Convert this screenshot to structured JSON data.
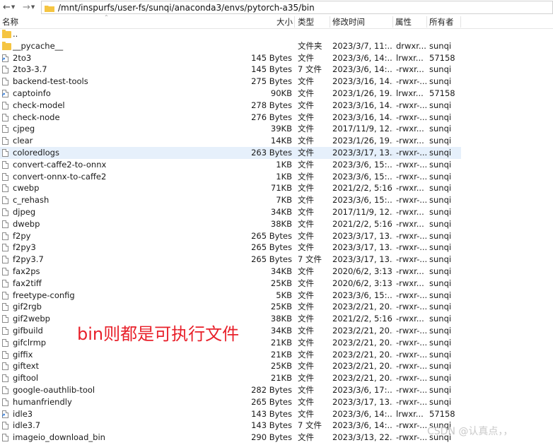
{
  "path": "/mnt/inspurfs/user-fs/sunqi/anaconda3/envs/pytorch-a35/bin",
  "headers": {
    "name": "名称",
    "size": "大小",
    "type": "类型",
    "modified": "修改时间",
    "attributes": "属性",
    "owner": "所有者"
  },
  "rows": [
    {
      "icon": "folder",
      "name": "..",
      "size": "",
      "type": "",
      "modified": "",
      "perm": "",
      "owner": ""
    },
    {
      "icon": "folder",
      "name": "__pycache__",
      "size": "",
      "type": "文件夹",
      "modified": "2023/3/7, 11:...",
      "perm": "drwxr...",
      "owner": "sunqi"
    },
    {
      "icon": "link",
      "name": "2to3",
      "size": "145 Bytes",
      "type": "文件",
      "modified": "2023/3/6, 14:...",
      "perm": "lrwxr...",
      "owner": "57158"
    },
    {
      "icon": "file",
      "name": "2to3-3.7",
      "size": "145 Bytes",
      "type": "7 文件",
      "modified": "2023/3/6, 14:...",
      "perm": "-rwxr...",
      "owner": "sunqi"
    },
    {
      "icon": "file",
      "name": "backend-test-tools",
      "size": "275 Bytes",
      "type": "文件",
      "modified": "2023/3/16, 14...",
      "perm": "-rwxr-...",
      "owner": "sunqi"
    },
    {
      "icon": "link",
      "name": "captoinfo",
      "size": "90KB",
      "type": "文件",
      "modified": "2023/1/26, 19...",
      "perm": "lrwxr...",
      "owner": "57158"
    },
    {
      "icon": "file",
      "name": "check-model",
      "size": "278 Bytes",
      "type": "文件",
      "modified": "2023/3/16, 14...",
      "perm": "-rwxr-...",
      "owner": "sunqi"
    },
    {
      "icon": "file",
      "name": "check-node",
      "size": "276 Bytes",
      "type": "文件",
      "modified": "2023/3/16, 14...",
      "perm": "-rwxr-...",
      "owner": "sunqi"
    },
    {
      "icon": "file",
      "name": "cjpeg",
      "size": "39KB",
      "type": "文件",
      "modified": "2017/11/9, 12...",
      "perm": "-rwxr...",
      "owner": "sunqi"
    },
    {
      "icon": "file",
      "name": "clear",
      "size": "14KB",
      "type": "文件",
      "modified": "2023/1/26, 19...",
      "perm": "-rwxr...",
      "owner": "sunqi"
    },
    {
      "icon": "file",
      "name": "coloredlogs",
      "size": "263 Bytes",
      "type": "文件",
      "modified": "2023/3/17, 13...",
      "perm": "-rwxr-...",
      "owner": "sunqi",
      "selected": true
    },
    {
      "icon": "file",
      "name": "convert-caffe2-to-onnx",
      "size": "1KB",
      "type": "文件",
      "modified": "2023/3/6, 15:...",
      "perm": "-rwxr-...",
      "owner": "sunqi"
    },
    {
      "icon": "file",
      "name": "convert-onnx-to-caffe2",
      "size": "1KB",
      "type": "文件",
      "modified": "2023/3/6, 15:...",
      "perm": "-rwxr-...",
      "owner": "sunqi"
    },
    {
      "icon": "file",
      "name": "cwebp",
      "size": "71KB",
      "type": "文件",
      "modified": "2021/2/2, 5:16",
      "perm": "-rwxr...",
      "owner": "sunqi"
    },
    {
      "icon": "file",
      "name": "c_rehash",
      "size": "7KB",
      "type": "文件",
      "modified": "2023/3/6, 15:...",
      "perm": "-rwxr-...",
      "owner": "sunqi"
    },
    {
      "icon": "file",
      "name": "djpeg",
      "size": "34KB",
      "type": "文件",
      "modified": "2017/11/9, 12...",
      "perm": "-rwxr...",
      "owner": "sunqi"
    },
    {
      "icon": "file",
      "name": "dwebp",
      "size": "38KB",
      "type": "文件",
      "modified": "2021/2/2, 5:16",
      "perm": "-rwxr...",
      "owner": "sunqi"
    },
    {
      "icon": "file",
      "name": "f2py",
      "size": "265 Bytes",
      "type": "文件",
      "modified": "2023/3/17, 13...",
      "perm": "-rwxr-...",
      "owner": "sunqi"
    },
    {
      "icon": "file",
      "name": "f2py3",
      "size": "265 Bytes",
      "type": "文件",
      "modified": "2023/3/17, 13...",
      "perm": "-rwxr-...",
      "owner": "sunqi"
    },
    {
      "icon": "file",
      "name": "f2py3.7",
      "size": "265 Bytes",
      "type": "7 文件",
      "modified": "2023/3/17, 13...",
      "perm": "-rwxr-...",
      "owner": "sunqi"
    },
    {
      "icon": "file",
      "name": "fax2ps",
      "size": "34KB",
      "type": "文件",
      "modified": "2020/6/2, 3:13",
      "perm": "-rwxr...",
      "owner": "sunqi"
    },
    {
      "icon": "file",
      "name": "fax2tiff",
      "size": "25KB",
      "type": "文件",
      "modified": "2020/6/2, 3:13",
      "perm": "-rwxr...",
      "owner": "sunqi"
    },
    {
      "icon": "file",
      "name": "freetype-config",
      "size": "5KB",
      "type": "文件",
      "modified": "2023/3/6, 15:...",
      "perm": "-rwxr-...",
      "owner": "sunqi"
    },
    {
      "icon": "file",
      "name": "gif2rgb",
      "size": "25KB",
      "type": "文件",
      "modified": "2023/2/21, 20...",
      "perm": "-rwxr-...",
      "owner": "sunqi"
    },
    {
      "icon": "file",
      "name": "gif2webp",
      "size": "38KB",
      "type": "文件",
      "modified": "2021/2/2, 5:16",
      "perm": "-rwxr...",
      "owner": "sunqi"
    },
    {
      "icon": "file",
      "name": "gifbuild",
      "size": "34KB",
      "type": "文件",
      "modified": "2023/2/21, 20...",
      "perm": "-rwxr-...",
      "owner": "sunqi"
    },
    {
      "icon": "file",
      "name": "gifclrmp",
      "size": "21KB",
      "type": "文件",
      "modified": "2023/2/21, 20...",
      "perm": "-rwxr-...",
      "owner": "sunqi"
    },
    {
      "icon": "file",
      "name": "giffix",
      "size": "21KB",
      "type": "文件",
      "modified": "2023/2/21, 20...",
      "perm": "-rwxr-...",
      "owner": "sunqi"
    },
    {
      "icon": "file",
      "name": "giftext",
      "size": "25KB",
      "type": "文件",
      "modified": "2023/2/21, 20...",
      "perm": "-rwxr-...",
      "owner": "sunqi"
    },
    {
      "icon": "file",
      "name": "giftool",
      "size": "21KB",
      "type": "文件",
      "modified": "2023/2/21, 20...",
      "perm": "-rwxr-...",
      "owner": "sunqi"
    },
    {
      "icon": "file",
      "name": "google-oauthlib-tool",
      "size": "282 Bytes",
      "type": "文件",
      "modified": "2023/3/6, 17:...",
      "perm": "-rwxr-...",
      "owner": "sunqi"
    },
    {
      "icon": "file",
      "name": "humanfriendly",
      "size": "265 Bytes",
      "type": "文件",
      "modified": "2023/3/17, 13...",
      "perm": "-rwxr-...",
      "owner": "sunqi"
    },
    {
      "icon": "link",
      "name": "idle3",
      "size": "143 Bytes",
      "type": "文件",
      "modified": "2023/3/6, 14:...",
      "perm": "lrwxr...",
      "owner": "57158"
    },
    {
      "icon": "file",
      "name": "idle3.7",
      "size": "143 Bytes",
      "type": "7 文件",
      "modified": "2023/3/6, 14:...",
      "perm": "-rwxr-...",
      "owner": "sunqi"
    },
    {
      "icon": "file",
      "name": "imageio_download_bin",
      "size": "290 Bytes",
      "type": "文件",
      "modified": "2023/3/13, 22...",
      "perm": "-rwxr-...",
      "owner": "sunqi"
    }
  ],
  "annotation": "bin则都是可执行文件",
  "watermark": "CSDN @认真点，，",
  "colors": {
    "annotation": "#e8202a",
    "selected_row": "#e6f0fb",
    "folder": "#f5c542"
  }
}
